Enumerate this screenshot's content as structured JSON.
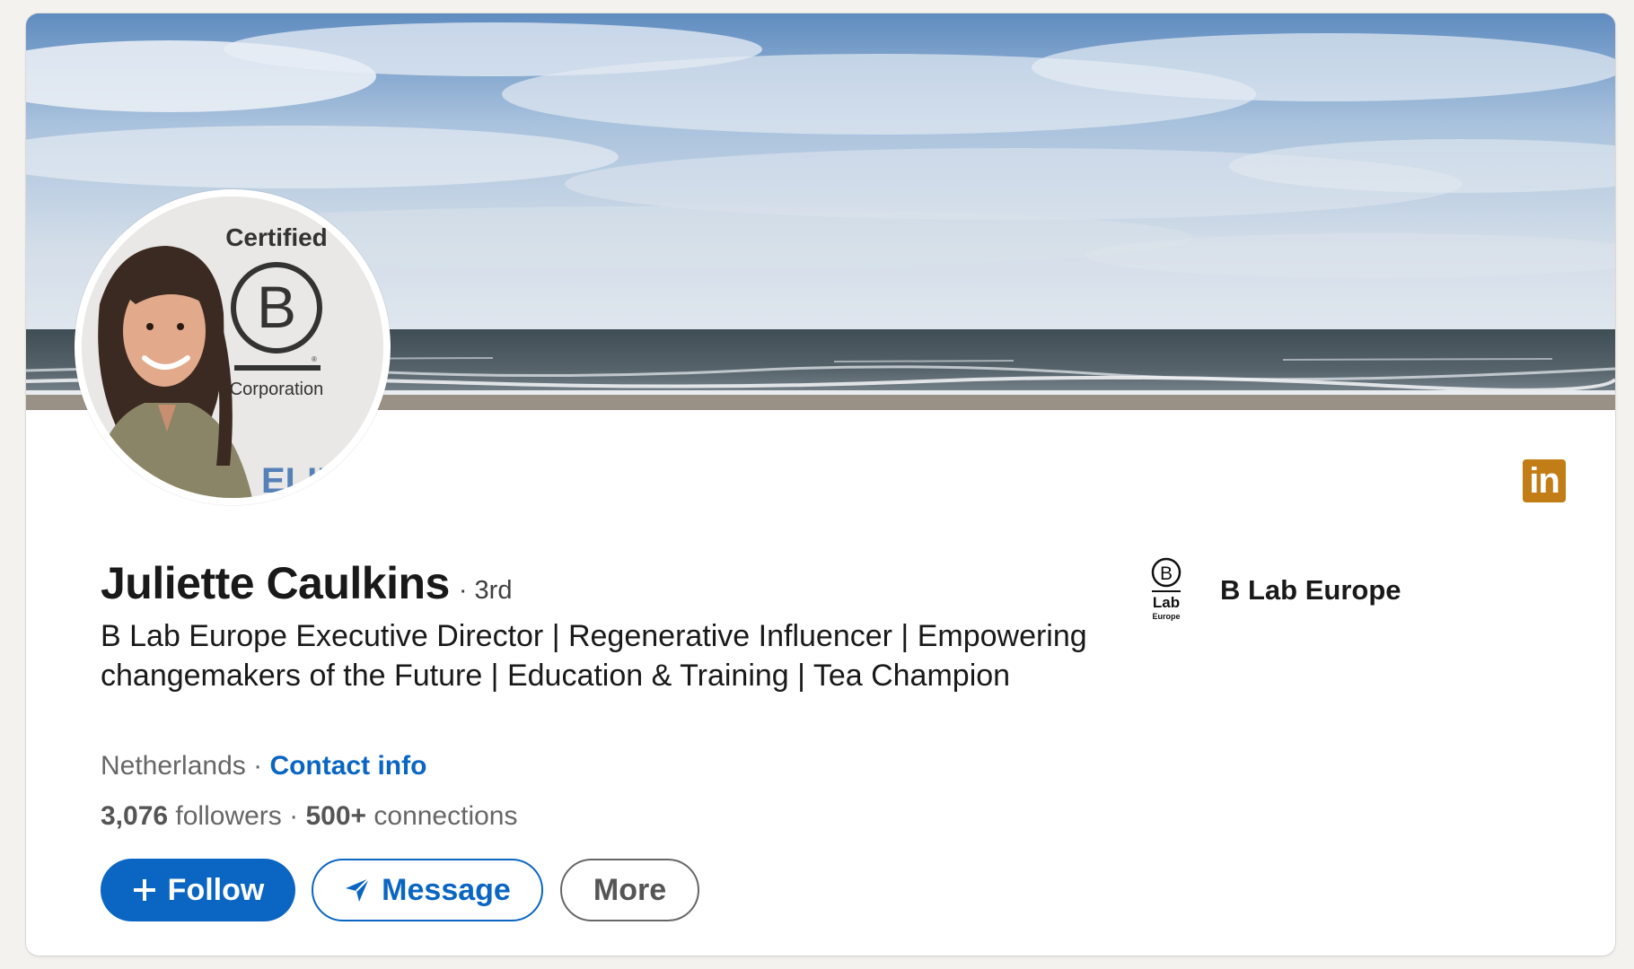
{
  "profile": {
    "name": "Juliette Caulkins",
    "degree": "· 3rd",
    "headline": "B Lab Europe Executive Director | Regenerative Influencer | Empowering changemakers of the Future | Education & Training | Tea Champion",
    "location": "Netherlands",
    "location_separator": " · ",
    "contact_info_label": "Contact info",
    "followers_count": "3,076",
    "followers_label": " followers",
    "stats_separator": "  · ",
    "connections_count": "500+",
    "connections_label": " connections"
  },
  "photo_text": {
    "certified": "Certified",
    "b_letter": "B",
    "corporation": "Corporation",
    "registered": "®",
    "partial_word": "ELIEV"
  },
  "actions": {
    "follow_label": "Follow",
    "message_label": "Message",
    "more_label": "More"
  },
  "company": {
    "name": "B Lab Europe",
    "logo_b": "B",
    "logo_lab": "Lab",
    "logo_europe": "Europe"
  },
  "badge": {
    "label": "in"
  },
  "icons": {
    "follow": "plus-icon",
    "message": "send-icon",
    "badge": "linkedin-icon"
  },
  "colors": {
    "primary": "#0a66c2",
    "badge": "#c37d16",
    "text": "#191919",
    "muted": "#666666"
  }
}
